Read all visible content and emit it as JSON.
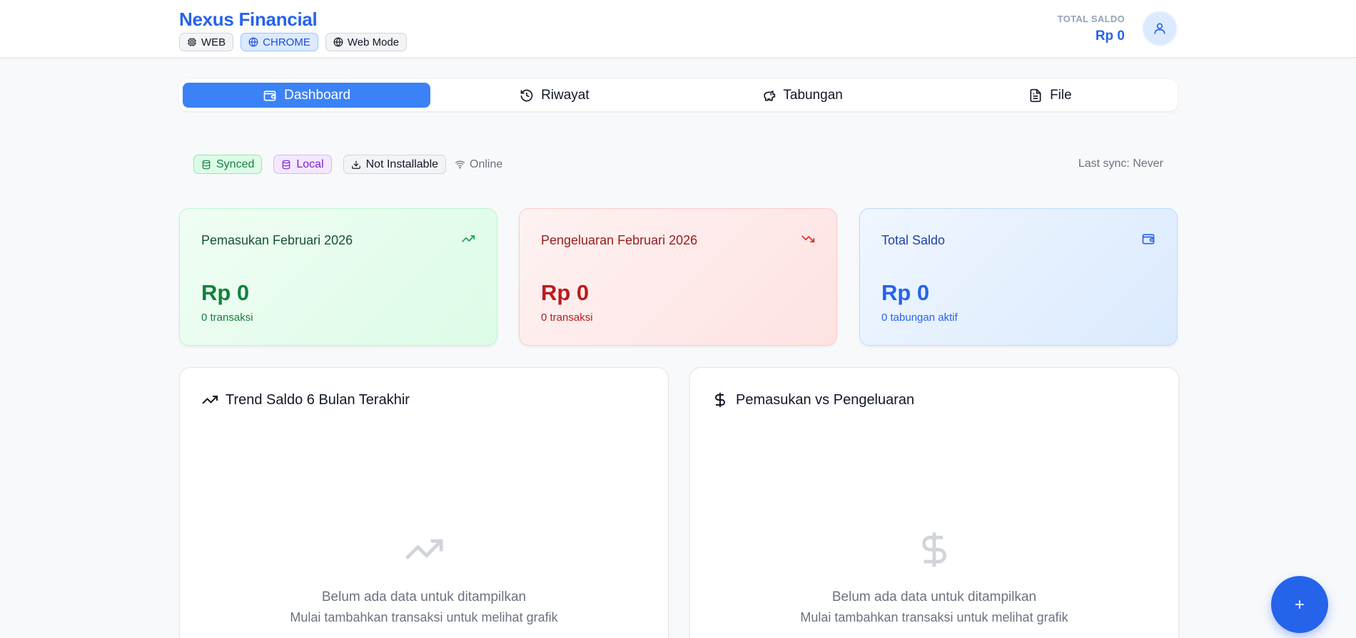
{
  "header": {
    "brand": "Nexus Financial",
    "chips": [
      {
        "label": "WEB",
        "icon": "chip-icon"
      },
      {
        "label": "CHROME",
        "icon": "globe-icon"
      },
      {
        "label": "Web Mode",
        "icon": "globe-icon"
      }
    ],
    "saldo_label": "TOTAL SALDO",
    "saldo_value": "Rp 0",
    "avatar_icon": "user-icon"
  },
  "tabs": [
    {
      "label": "Dashboard",
      "icon": "wallet-icon",
      "active": true
    },
    {
      "label": "Riwayat",
      "icon": "history-icon",
      "active": false
    },
    {
      "label": "Tabungan",
      "icon": "piggy-bank-icon",
      "active": false
    },
    {
      "label": "File",
      "icon": "file-icon",
      "active": false
    }
  ],
  "status": {
    "synced": "Synced",
    "local": "Local",
    "installable": "Not Installable",
    "online": "Online",
    "last_sync": "Last sync: Never"
  },
  "cards": {
    "income": {
      "title": "Pemasukan Februari 2026",
      "amount": "Rp 0",
      "sub": "0 transaksi",
      "icon": "trending-up-icon"
    },
    "expense": {
      "title": "Pengeluaran Februari 2026",
      "amount": "Rp 0",
      "sub": "0 transaksi",
      "icon": "trending-down-icon"
    },
    "balance": {
      "title": "Total Saldo",
      "amount": "Rp 0",
      "sub": "0 tabungan aktif",
      "icon": "wallet-icon"
    }
  },
  "panels": {
    "trend": {
      "title": "Trend Saldo 6 Bulan Terakhir",
      "empty_main": "Belum ada data untuk ditampilkan",
      "empty_sub": "Mulai tambahkan transaksi untuk melihat grafik"
    },
    "compare": {
      "title": "Pemasukan vs Pengeluaran",
      "empty_main": "Belum ada data untuk ditampilkan",
      "empty_sub": "Mulai tambahkan transaksi untuk melihat grafik"
    }
  },
  "fab": {
    "icon": "plus-icon"
  },
  "colors": {
    "primary": "#2563eb",
    "income": "#15803d",
    "expense": "#b91c1c"
  }
}
